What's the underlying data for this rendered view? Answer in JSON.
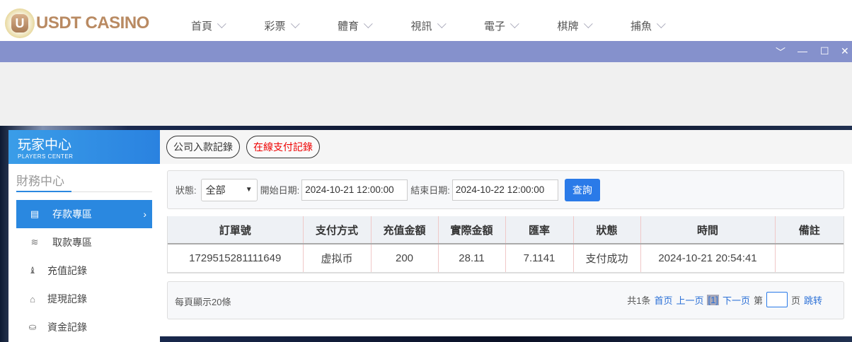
{
  "header": {
    "logo_text": "USDT CASINO",
    "logo_letter": "U",
    "nav": [
      "首頁",
      "彩票",
      "體育",
      "視訊",
      "電子",
      "棋牌",
      "捕魚"
    ]
  },
  "window_controls": {
    "collapse": "﹀",
    "minimize": "—",
    "maximize": "☐",
    "close": "✕"
  },
  "sidebar": {
    "title": "玩家中心",
    "subtitle": "PLAYERS CENTER",
    "section": "財務中心",
    "items": [
      {
        "label": "存款專區",
        "icon": "card-icon",
        "active": true
      },
      {
        "label": "取款專區",
        "icon": "hand-cash-icon"
      },
      {
        "label": "充值記錄",
        "icon": "money-bag-icon"
      },
      {
        "label": "提現記錄",
        "icon": "wallet-icon"
      },
      {
        "label": "資金記錄",
        "icon": "piggy-bank-icon"
      }
    ]
  },
  "tabs": [
    "公司入款記錄",
    "在線支付記錄"
  ],
  "filter": {
    "status_label": "狀態:",
    "status_value": "全部",
    "start_label": "開始日期:",
    "start_value": "2024-10-21 12:00:00",
    "end_label": "結束日期:",
    "end_value": "2024-10-22 12:00:00",
    "query_button": "查詢"
  },
  "table": {
    "columns": [
      "訂單號",
      "支付方式",
      "充值金額",
      "實際金額",
      "匯率",
      "狀態",
      "時間",
      "備註"
    ],
    "rows": [
      [
        "1729515281111649",
        "虚拟币",
        "200",
        "28.11",
        "7.1141",
        "支付成功",
        "2024-10-21 20:54:41",
        ""
      ]
    ]
  },
  "pager": {
    "per_page": "每頁顯示20條",
    "total": "共1条",
    "first": "首页",
    "prev": "上一页",
    "current": "[1]",
    "next": "下一页",
    "page_prefix": "第",
    "page_suffix": "页",
    "jump": "跳转"
  },
  "colors": {
    "accent": "#2a88e0",
    "titlebar": "#8591cc",
    "active_tab_text": "#ee0000"
  }
}
